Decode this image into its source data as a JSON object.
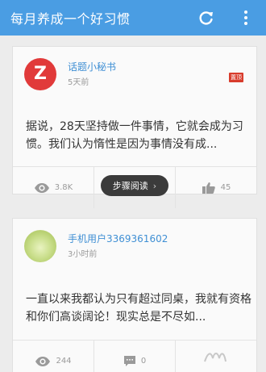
{
  "appbar": {
    "title": "每月养成一个好习惯",
    "refresh_icon": "refresh-icon",
    "more_icon": "more-vertical-icon"
  },
  "posts": [
    {
      "user_name": "话题小秘书",
      "time": "5天前",
      "badge": "置顶",
      "avatar_letter": "Z",
      "excerpt": "据说，28天坚持做一件事情，它就会成为习惯。我们认为惰性是因为事情没有成...",
      "views": "3.8K",
      "likes": "45"
    },
    {
      "user_name": "手机用户3369361602",
      "time": "3小时前",
      "excerpt": "一直以来我都认为只有超过同桌，我就有资格和你们高谈阔论！现实总是不尽如...",
      "views": "244",
      "comments": "0"
    }
  ],
  "toast": {
    "label": "步骤阅读"
  },
  "colors": {
    "appbar": "#4a9de3",
    "username": "#3f8fd4",
    "badge": "#d83c2c",
    "avatar_red": "#e13a3a"
  }
}
